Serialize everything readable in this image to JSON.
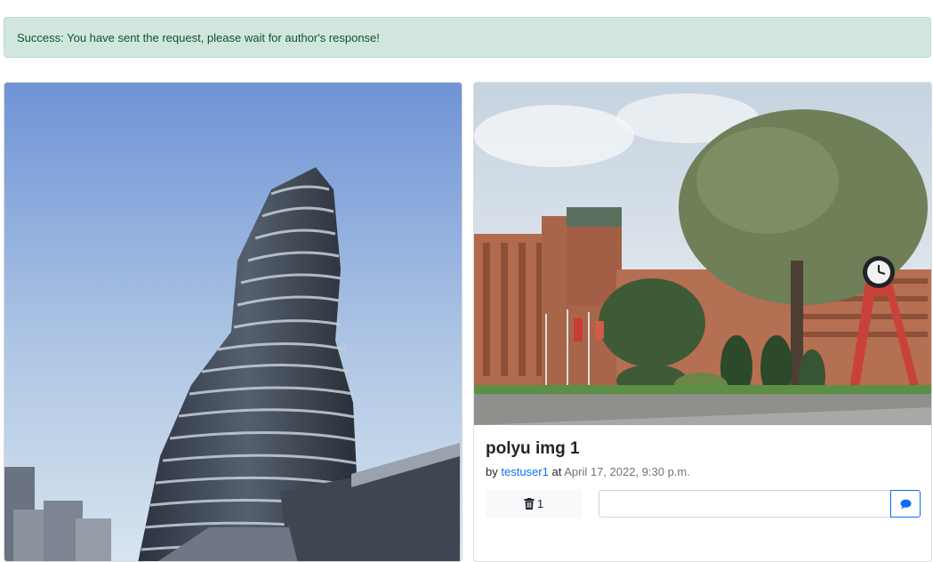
{
  "alert": {
    "message": "Success: You have sent the request, please wait for author's response!",
    "color": "#d1e7dd"
  },
  "posts": [
    {
      "image_alt": "Tower building against blue sky"
    },
    {
      "image_alt": "Campus with tree and clock tower",
      "title": "polyu img 1",
      "by_label": "by",
      "author": "testuser1",
      "at_label": "at",
      "date": "April 17, 2022, 9:30 p.m.",
      "delete_icon": "trash-icon",
      "delete_count": "1",
      "comment_placeholder": "",
      "send_icon": "comment-icon"
    }
  ],
  "colors": {
    "link": "#0d6efd",
    "success_bg": "#d1e7dd",
    "success_text": "#0f5132"
  }
}
